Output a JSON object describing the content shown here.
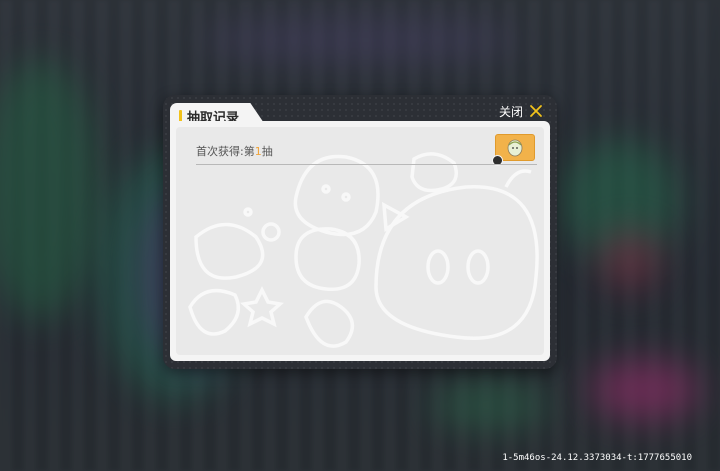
{
  "dialog": {
    "title": "抽取记录",
    "close_label": "关闭"
  },
  "records": [
    {
      "prefix": "首次获得:第",
      "number": "1",
      "suffix": "抽",
      "item_icon": "pet-egg-icon"
    }
  ],
  "footer": {
    "build_id": "1-5m46os-24.12.3373034-t:1777655010"
  },
  "colors": {
    "accent_yellow": "#f2c21b",
    "dialog_bg": "#2c2f35",
    "panel_bg": "#f4f4f4",
    "highlight_number": "#f0a43a",
    "item_card": "#f2b24a"
  }
}
